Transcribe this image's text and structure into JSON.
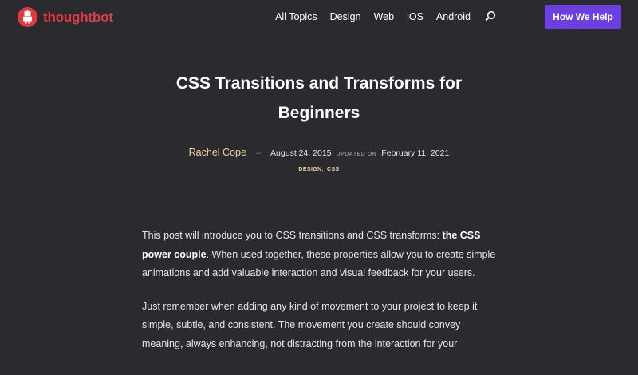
{
  "brand": {
    "name": "thoughtbot",
    "color": "#e03a3e"
  },
  "nav": {
    "items": [
      "All Topics",
      "Design",
      "Web",
      "iOS",
      "Android"
    ],
    "cta_label": "How We Help",
    "cta_color": "#6b3fe0"
  },
  "article": {
    "title": "CSS Transitions and Transforms for Beginners",
    "author": "Rachel Cope",
    "date": "August 24, 2015",
    "updated_label": "UPDATED ON",
    "updated_date": "February 11, 2021",
    "tags": [
      "DESIGN",
      "CSS"
    ],
    "p1_lead": "This post will introduce you to CSS transitions and CSS transforms: ",
    "p1_bold": "the CSS power couple",
    "p1_rest": ". When used together, these properties allow you to create simple animations and add valuable interaction and visual feedback for your users.",
    "p2": "Just remember when adding any kind of movement to your project to keep it simple, subtle, and consistent. The movement you create should convey meaning, always enhancing, not distracting from the interaction for your"
  }
}
